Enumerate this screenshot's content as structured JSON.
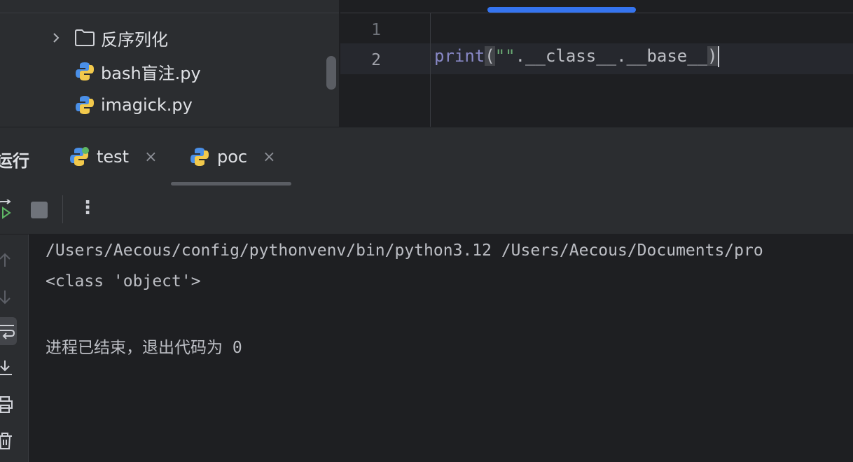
{
  "project_tree": {
    "items": [
      {
        "label": "反序列化",
        "type": "folder",
        "icon": "folder-icon"
      },
      {
        "label": "bash盲注.py",
        "type": "file",
        "icon": "python-file-icon"
      },
      {
        "label": "imagick.py",
        "type": "file",
        "icon": "python-file-icon"
      }
    ]
  },
  "editor": {
    "line_numbers": [
      "1",
      "2"
    ],
    "code_fn": "print",
    "code_open": "(",
    "code_str": "\"\"",
    "code_rest": ".__class__.__base__",
    "code_close": ")"
  },
  "run_panel": {
    "title": "运行",
    "tabs": [
      {
        "label": "test",
        "close": "×"
      },
      {
        "label": "poc",
        "close": "×"
      }
    ],
    "toolbar": {
      "more": "⋮"
    }
  },
  "console": {
    "lines": [
      "/Users/Aecous/config/pythonvenv/bin/python3.12 /Users/Aecous/Documents/pro",
      "<class 'object'>",
      "",
      "进程已结束，退出代码为 0"
    ]
  },
  "colors": {
    "accent": "#3574f0",
    "background": "#1e1f22",
    "panel": "#2b2d30"
  }
}
